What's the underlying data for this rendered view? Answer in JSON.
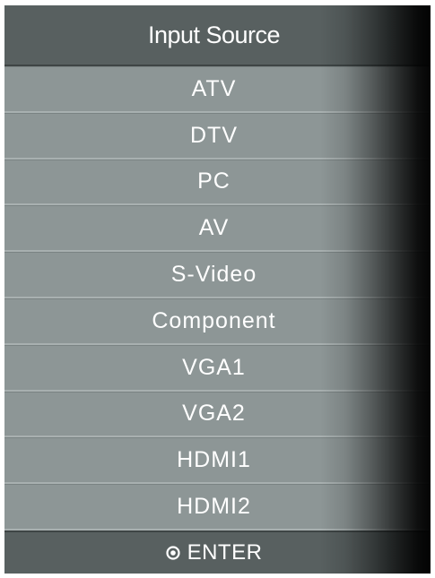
{
  "menu": {
    "title": "Input Source",
    "items": [
      {
        "label": "ATV"
      },
      {
        "label": "DTV"
      },
      {
        "label": "PC"
      },
      {
        "label": "AV"
      },
      {
        "label": "S-Video"
      },
      {
        "label": "Component"
      },
      {
        "label": "VGA1"
      },
      {
        "label": "VGA2"
      },
      {
        "label": "HDMI1"
      },
      {
        "label": "HDMI2"
      }
    ],
    "footer": {
      "icon": "enter-button-icon",
      "label": "ENTER"
    }
  },
  "colors": {
    "header_bg": "#586060",
    "item_bg": "#8d9696",
    "item_divider": "#a8b0b0",
    "text": "#ffffff"
  }
}
